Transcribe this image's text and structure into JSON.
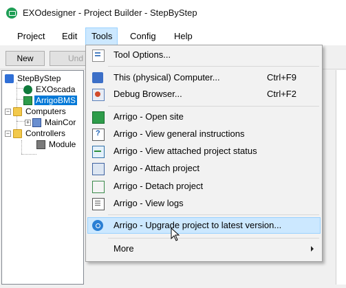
{
  "window": {
    "title": "EXOdesigner - Project Builder - StepByStep"
  },
  "menubar": {
    "items": [
      "Project",
      "Edit",
      "Tools",
      "Config",
      "Help"
    ],
    "open_menu": "Tools"
  },
  "toolbar": {
    "new_label": "New",
    "undo_label": "Und"
  },
  "tree": {
    "root": "StepByStep",
    "nodes": [
      {
        "label": "EXOscada",
        "icon": "scada-icon"
      },
      {
        "label": "ArrigoBMS",
        "icon": "arrigo-site-icon",
        "selected": true
      },
      {
        "label": "Computers",
        "icon": "folder-icon"
      },
      {
        "label": "MainCor",
        "icon": "computer-icon"
      },
      {
        "label": "Controllers",
        "icon": "folder-icon"
      },
      {
        "label": "Module",
        "icon": "module-icon"
      }
    ]
  },
  "tools_menu": {
    "items": [
      {
        "label": "Tool Options...",
        "icon": "tool-options-icon"
      },
      {
        "label": "This (physical) Computer...",
        "shortcut": "Ctrl+F9",
        "icon": "computer-icon"
      },
      {
        "label": "Debug Browser...",
        "shortcut": "Ctrl+F2",
        "icon": "debug-browser-icon"
      },
      {
        "label": "Arrigo - Open site",
        "icon": "arrigo-site-icon"
      },
      {
        "label": "Arrigo - View general instructions",
        "icon": "instructions-icon"
      },
      {
        "label": "Arrigo - View attached project status",
        "icon": "project-status-icon"
      },
      {
        "label": "Arrigo - Attach project",
        "icon": "attach-icon"
      },
      {
        "label": "Arrigo - Detach project",
        "icon": "detach-icon"
      },
      {
        "label": "Arrigo - View logs",
        "icon": "logs-icon"
      },
      {
        "label": "Arrigo - Upgrade project to latest version...",
        "icon": "upgrade-icon",
        "highlighted": true
      },
      {
        "label": "More",
        "icon": "submenu-arrow-icon"
      }
    ]
  },
  "colors": {
    "menu_highlight": "#cce8ff",
    "menu_highlight_border": "#99d1ff",
    "selection": "#0078d7"
  }
}
